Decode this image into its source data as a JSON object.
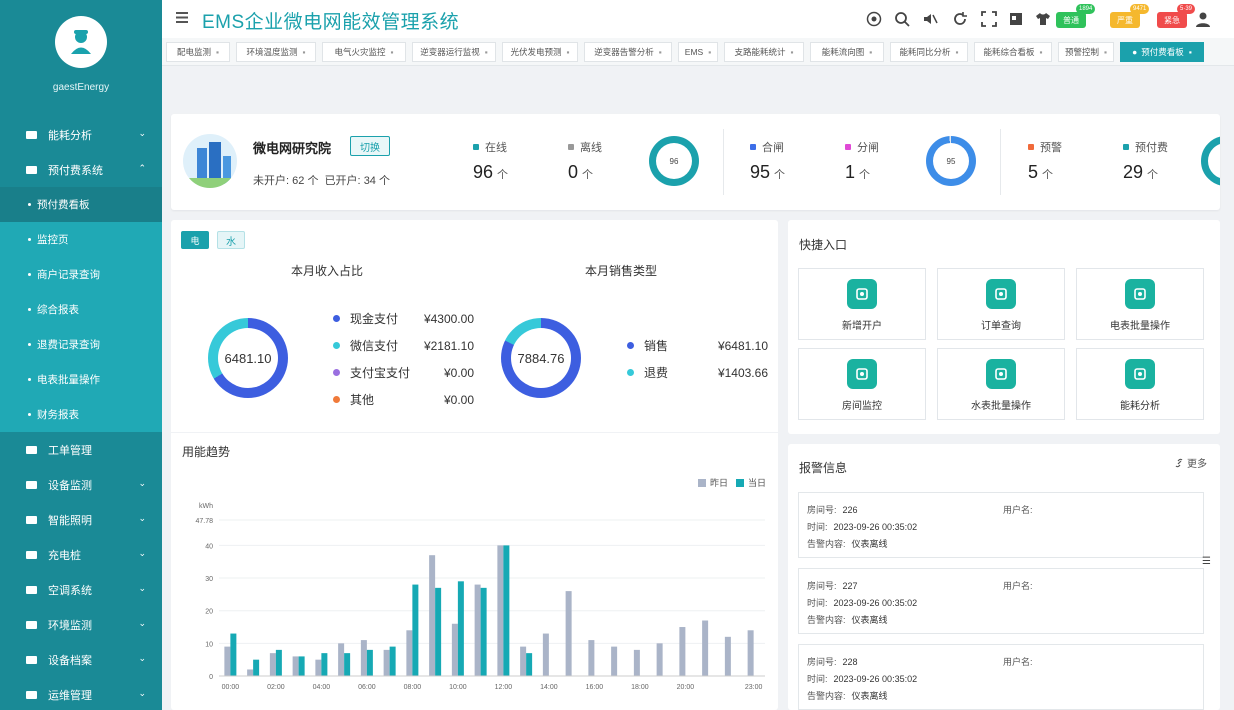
{
  "app": {
    "title": "EMS企业微电网能效管理系统",
    "brand": "gaestEnergy"
  },
  "header_badges": [
    {
      "label": "普通",
      "count": "1894",
      "color": "#2fc25b"
    },
    {
      "label": "严重",
      "count": "9471",
      "color": "#f5b82e"
    },
    {
      "label": "紧急",
      "count": "5·39",
      "color": "#f04b4b"
    }
  ],
  "sidebar": {
    "items": [
      {
        "label": "能耗分析",
        "icon": "bar-chart-icon",
        "chev": "⌄"
      },
      {
        "label": "预付费系统",
        "icon": "wallet-icon",
        "chev": "⌃"
      },
      {
        "label": "工单管理",
        "icon": "ticket-icon",
        "chev": ""
      },
      {
        "label": "设备监测",
        "icon": "monitor-icon",
        "chev": "⌄"
      },
      {
        "label": "智能照明",
        "icon": "bulb-icon",
        "chev": "⌄"
      },
      {
        "label": "充电桩",
        "icon": "charger-icon",
        "chev": "⌄"
      },
      {
        "label": "空调系统",
        "icon": "aircon-icon",
        "chev": "⌄"
      },
      {
        "label": "环境监测",
        "icon": "env-icon",
        "chev": "⌄"
      },
      {
        "label": "设备档案",
        "icon": "archive-icon",
        "chev": "⌄"
      },
      {
        "label": "运维管理",
        "icon": "ops-icon",
        "chev": "⌄"
      }
    ],
    "subitems": [
      "预付费看板",
      "监控页",
      "商户记录查询",
      "综合报表",
      "退费记录查询",
      "电表批量操作",
      "财务报表"
    ]
  },
  "tabs": [
    "配电监测",
    "环境温度监测",
    "电气火灾监控",
    "逆变器运行监视",
    "光伏发电预测",
    "逆变器告警分析",
    "EMS",
    "支路能耗统计",
    "能耗流向图",
    "能耗同比分析",
    "能耗综合看板",
    "预警控制",
    "预付费看板"
  ],
  "summary": {
    "org_name": "微电网研究院",
    "switch_label": "切换",
    "unopened_label": "未开户:",
    "unopened_value": "62",
    "unit_ge": "个",
    "opened_label": "已开户:",
    "opened_value": "34",
    "groups": [
      {
        "a_label": "在线",
        "a_value": "96",
        "a_color": "#1ba1ac",
        "b_label": "离线",
        "b_value": "0",
        "b_color": "#999999",
        "ring": "96",
        "ring_pct": 100,
        "ring_color": "#1ba1ac"
      },
      {
        "a_label": "合闸",
        "a_value": "95",
        "a_color": "#3d6ee8",
        "b_label": "分闸",
        "b_value": "1",
        "b_color": "#e04ad6",
        "ring": "95",
        "ring_pct": 99,
        "ring_color": "#3d8de8"
      },
      {
        "a_label": "预警",
        "a_value": "5",
        "a_color": "#f06a3a",
        "b_label": "预付费",
        "b_value": "29",
        "b_color": "#1ba1ac",
        "ring": "",
        "ring_pct": 100,
        "ring_color": "#1ba1ac"
      }
    ]
  },
  "income": {
    "toggle_elec": "电",
    "toggle_water": "水",
    "left_title": "本月收入占比",
    "left_center": "6481.10",
    "left_legend": [
      {
        "label": "现金支付",
        "amount": "¥4300.00",
        "color": "#3d5ee0"
      },
      {
        "label": "微信支付",
        "amount": "¥2181.10",
        "color": "#36c9d9"
      },
      {
        "label": "支付宝支付",
        "amount": "¥0.00",
        "color": "#9a6fe0"
      },
      {
        "label": "其他",
        "amount": "¥0.00",
        "color": "#f07a3a"
      }
    ],
    "right_title": "本月销售类型",
    "right_center": "7884.76",
    "right_legend": [
      {
        "label": "销售",
        "amount": "¥6481.10",
        "color": "#3d5ee0"
      },
      {
        "label": "退费",
        "amount": "¥1403.66",
        "color": "#36c9d9"
      }
    ]
  },
  "trend": {
    "title": "用能趋势",
    "legend_yesterday": "昨日",
    "legend_today": "当日"
  },
  "chart_data": {
    "type": "bar",
    "title": "用能趋势",
    "ylabel": "kWh",
    "ylim": [
      0,
      47.78
    ],
    "yticks": [
      "47.78",
      "40",
      "30",
      "20",
      "10",
      "0"
    ],
    "ytick_values": [
      47.78,
      40,
      30,
      20,
      10,
      0
    ],
    "xtick_labels": [
      "00:00",
      "02:00",
      "04:00",
      "06:00",
      "08:00",
      "10:00",
      "12:00",
      "14:00",
      "16:00",
      "18:00",
      "20:00",
      "23:00"
    ],
    "xtick_index": [
      0,
      2,
      4,
      6,
      8,
      10,
      12,
      14,
      16,
      18,
      20,
      23
    ],
    "categories": [
      "00",
      "01",
      "02",
      "03",
      "04",
      "05",
      "06",
      "07",
      "08",
      "09",
      "10",
      "11",
      "12",
      "13",
      "14",
      "15",
      "16",
      "17",
      "18",
      "19",
      "20",
      "21",
      "22",
      "23"
    ],
    "series": [
      {
        "name": "昨日",
        "color": "#aab4c8",
        "values": [
          9,
          2,
          7,
          6,
          5,
          10,
          11,
          8,
          14,
          37,
          16,
          28,
          40,
          9,
          13,
          26,
          11,
          9,
          8,
          10,
          15,
          17,
          12,
          14
        ]
      },
      {
        "name": "当日",
        "color": "#16a9b4",
        "values": [
          13,
          5,
          8,
          6,
          7,
          7,
          8,
          9,
          28,
          27,
          29,
          27,
          40,
          7,
          null,
          null,
          null,
          null,
          null,
          null,
          null,
          null,
          null,
          null
        ]
      }
    ]
  },
  "quick": {
    "title": "快捷入口",
    "items": [
      {
        "label": "新增开户",
        "icon": "user-add-icon"
      },
      {
        "label": "订单查询",
        "icon": "order-search-icon"
      },
      {
        "label": "电表批量操作",
        "icon": "meter-batch-icon"
      },
      {
        "label": "房间监控",
        "icon": "room-monitor-icon"
      },
      {
        "label": "水表批量操作",
        "icon": "water-meter-icon"
      },
      {
        "label": "能耗分析",
        "icon": "energy-analysis-icon"
      }
    ]
  },
  "alarms": {
    "title": "报警信息",
    "more": "更多",
    "room_label": "房间号:",
    "user_label": "用户名:",
    "time_label": "时间:",
    "content_label": "告警内容:",
    "items": [
      {
        "room": "226",
        "time": "2023-09-26 00:35:02",
        "content": "仪表离线"
      },
      {
        "room": "227",
        "time": "2023-09-26 00:35:02",
        "content": "仪表离线"
      },
      {
        "room": "228",
        "time": "2023-09-26 00:35:02",
        "content": "仪表离线"
      }
    ]
  }
}
